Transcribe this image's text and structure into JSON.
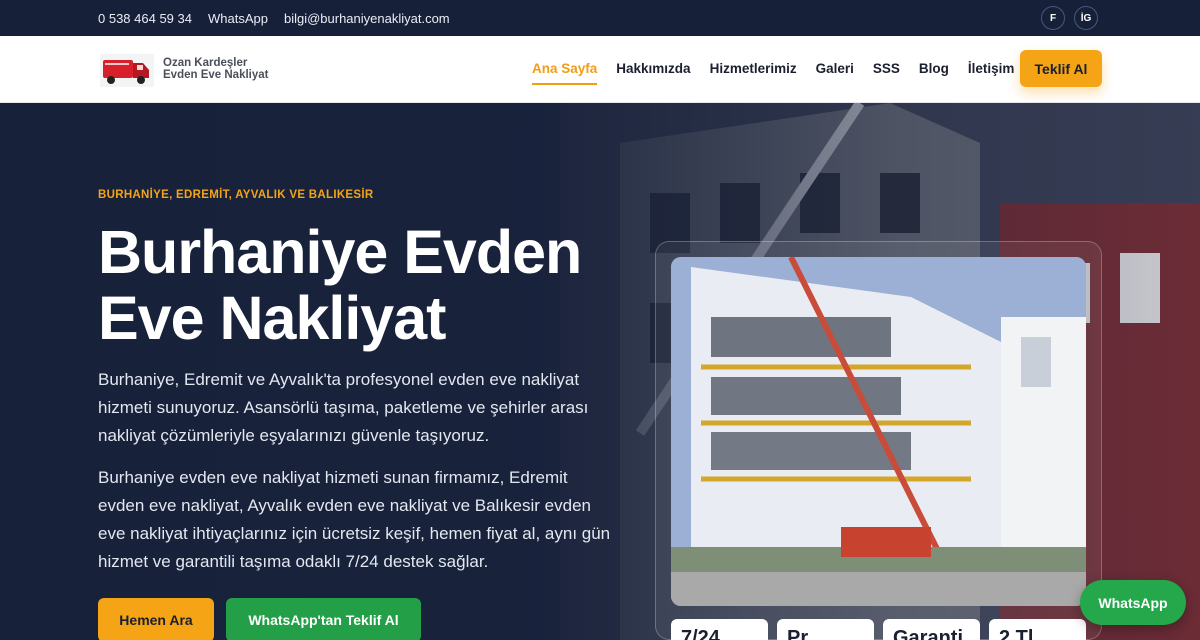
{
  "topbar": {
    "phone": "0 538 464 59 34",
    "whatsapp": "WhatsApp",
    "email": "bilgi@burhaniyenakliyat.com",
    "social": [
      {
        "label": "F",
        "icon": "facebook-icon"
      },
      {
        "label": "İG",
        "icon": "instagram-icon"
      }
    ]
  },
  "brand": {
    "line1": "Ozan Kardeşler",
    "line2": "Evden Eve Nakliyat"
  },
  "nav": {
    "items": [
      {
        "label": "Ana Sayfa",
        "active": true
      },
      {
        "label": "Hakkımızda"
      },
      {
        "label": "Hizmetlerimiz"
      },
      {
        "label": "Galeri"
      },
      {
        "label": "SSS"
      },
      {
        "label": "Blog"
      },
      {
        "label": "İletişim"
      }
    ],
    "cta": "Teklif Al"
  },
  "hero": {
    "eyebrow": "BURHANİYE, EDREMİT, AYVALIK VE BALIKESİR",
    "title": "Burhaniye Evden Eve Nakliyat",
    "paragraph1": "Burhaniye, Edremit ve Ayvalık'ta profesyonel evden eve nakliyat hizmeti sunuyoruz. Asansörlü taşıma, paketleme ve şehirler arası nakliyat çözümleriyle eşyalarınızı güvenle taşıyoruz.",
    "paragraph2": "Burhaniye evden eve nakliyat hizmeti sunan firmamız, Edremit evden eve nakliyat, Ayvalık evden eve nakliyat ve Balıkesir evden eve nakliyat ihtiyaçlarınız için ücretsiz keşif, hemen fiyat al, aynı gün hizmet ve garantili taşıma odaklı 7/24 destek sağlar.",
    "button_call": "Hemen Ara",
    "button_whatsapp": "WhatsApp'tan Teklif Al",
    "stats": [
      "7/24",
      "Pr...",
      "Garanti",
      "2 Tl..."
    ]
  },
  "floating_whatsapp": "WhatsApp",
  "colors": {
    "accent": "#f4a415",
    "navy": "#1c2742",
    "green": "#23a047"
  }
}
